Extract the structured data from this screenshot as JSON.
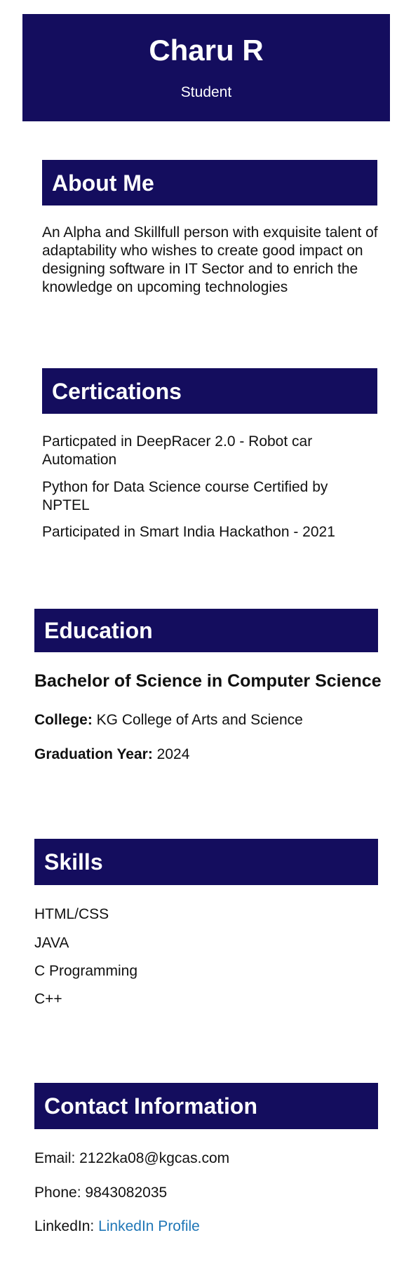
{
  "header": {
    "name": "Charu R",
    "role": "Student"
  },
  "about": {
    "heading": "About Me",
    "text": "An Alpha and Skillfull person with exquisite talent of adaptability who wishes to create good impact on designing software in IT Sector and to enrich the knowledge on upcoming technologies"
  },
  "certifications": {
    "heading": "Certications",
    "items": [
      "Particpated in DeepRacer 2.0 - Robot car Automation",
      "Python for Data Science course Certified by NPTEL",
      "Participated in Smart India Hackathon - 2021"
    ]
  },
  "education": {
    "heading": "Education",
    "degree": "Bachelor of Science in Computer Science",
    "college_label": "College:",
    "college_value": " KG College of Arts and Science",
    "year_label": "Graduation Year:",
    "year_value": " 2024"
  },
  "skills": {
    "heading": "Skills",
    "items": [
      "HTML/CSS",
      "JAVA",
      "C Programming",
      "C++"
    ]
  },
  "contact": {
    "heading": "Contact Information",
    "email": "Email: 2122ka08@kgcas.com",
    "phone": "Phone: 9843082035",
    "linkedin_label": "LinkedIn: ",
    "linkedin_link": "LinkedIn Profile"
  },
  "colors": {
    "banner": "#140d5e",
    "link": "#2077b7"
  }
}
